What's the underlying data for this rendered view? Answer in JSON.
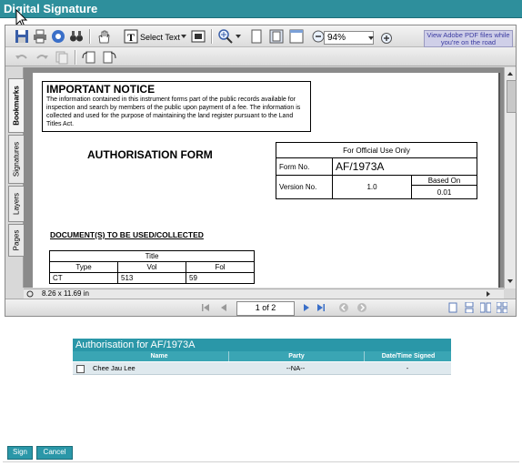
{
  "window": {
    "title": "Digital Signature"
  },
  "toolbar": {
    "select_text_label": "Select Text",
    "zoom_value": "94%",
    "adobe_link": "View Adobe PDF files while you're on the road"
  },
  "side_tabs": [
    "Bookmarks",
    "Signatures",
    "Layers",
    "Pages"
  ],
  "page_size": "8.26 x 11.69 in",
  "navigation": {
    "page_indicator": "1 of 2"
  },
  "document": {
    "notice_title": "IMPORTANT NOTICE",
    "notice_body": "The information contained in this instrument forms part of the public records available for inspection and search by members of the public upon payment of a fee. The information is collected and used for the purpose of maintaining the land register pursuant to the Land Titles Act.",
    "form_title": "AUTHORISATION FORM",
    "official_header": "For Official Use Only",
    "form_no_label": "Form No.",
    "form_no_value": "AF/1973A",
    "version_label": "Version No.",
    "version_value": "1.0",
    "based_on_label": "Based On",
    "based_on_value": "0.01",
    "documents_title": "DOCUMENT(S) TO BE USED/COLLECTED",
    "docs_table": {
      "title_header": "Title",
      "columns": [
        "Type",
        "Vol",
        "Fol"
      ],
      "rows": [
        [
          "CT",
          "513",
          "59"
        ]
      ]
    }
  },
  "authorisation": {
    "header": "Authorisation for AF/1973A",
    "columns": [
      "Name",
      "Party",
      "Date/Time Signed"
    ],
    "rows": [
      {
        "name": "Chee Jau Lee",
        "party": "--NA--",
        "date": "-"
      }
    ]
  },
  "buttons": {
    "sign": "Sign",
    "cancel": "Cancel"
  }
}
